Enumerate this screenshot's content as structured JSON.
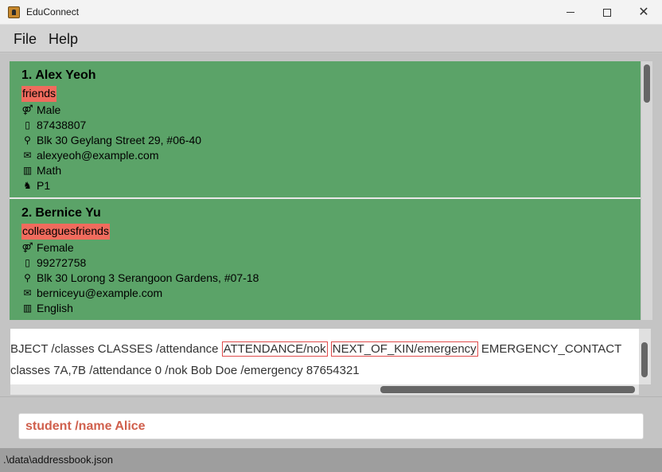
{
  "window": {
    "title": "EduConnect",
    "minimize_icon": "minimize-icon",
    "maximize_icon": "maximize-icon",
    "close_icon": "close-icon"
  },
  "menu": {
    "file": "File",
    "help": "Help"
  },
  "persons": [
    {
      "index": "1.",
      "name": "Alex Yeoh",
      "tag": "friends",
      "gender": "Male",
      "phone": "87438807",
      "address": "Blk 30 Geylang Street 29, #06-40",
      "email": "alexyeoh@example.com",
      "subject": "Math",
      "classes": "P1"
    },
    {
      "index": "2.",
      "name": "Bernice Yu",
      "tag": "colleaguesfriends",
      "gender": "Female",
      "phone": "99272758",
      "address": "Blk 30 Lorong 3 Serangoon Gardens, #07-18",
      "email": "berniceyu@example.com",
      "subject": "English"
    }
  ],
  "result": {
    "line1_pre": "BJECT /classes CLASSES /attendance ",
    "line1_err1": "ATTENDANCE/nok",
    "line1_err2": "NEXT_OF_KIN/emergency",
    "line1_post": " EMERGENCY_CONTACT",
    "line2": "classes 7A,7B /attendance 0 /nok Bob Doe /emergency 87654321"
  },
  "command": {
    "value": "student /name Alice"
  },
  "status": {
    "path": ".\\data\\addressbook.json"
  },
  "colors": {
    "card_bg": "#5ba368",
    "tag_bg": "#f06b5d",
    "command_text": "#d0604d",
    "error_border": "#e04c4c"
  }
}
